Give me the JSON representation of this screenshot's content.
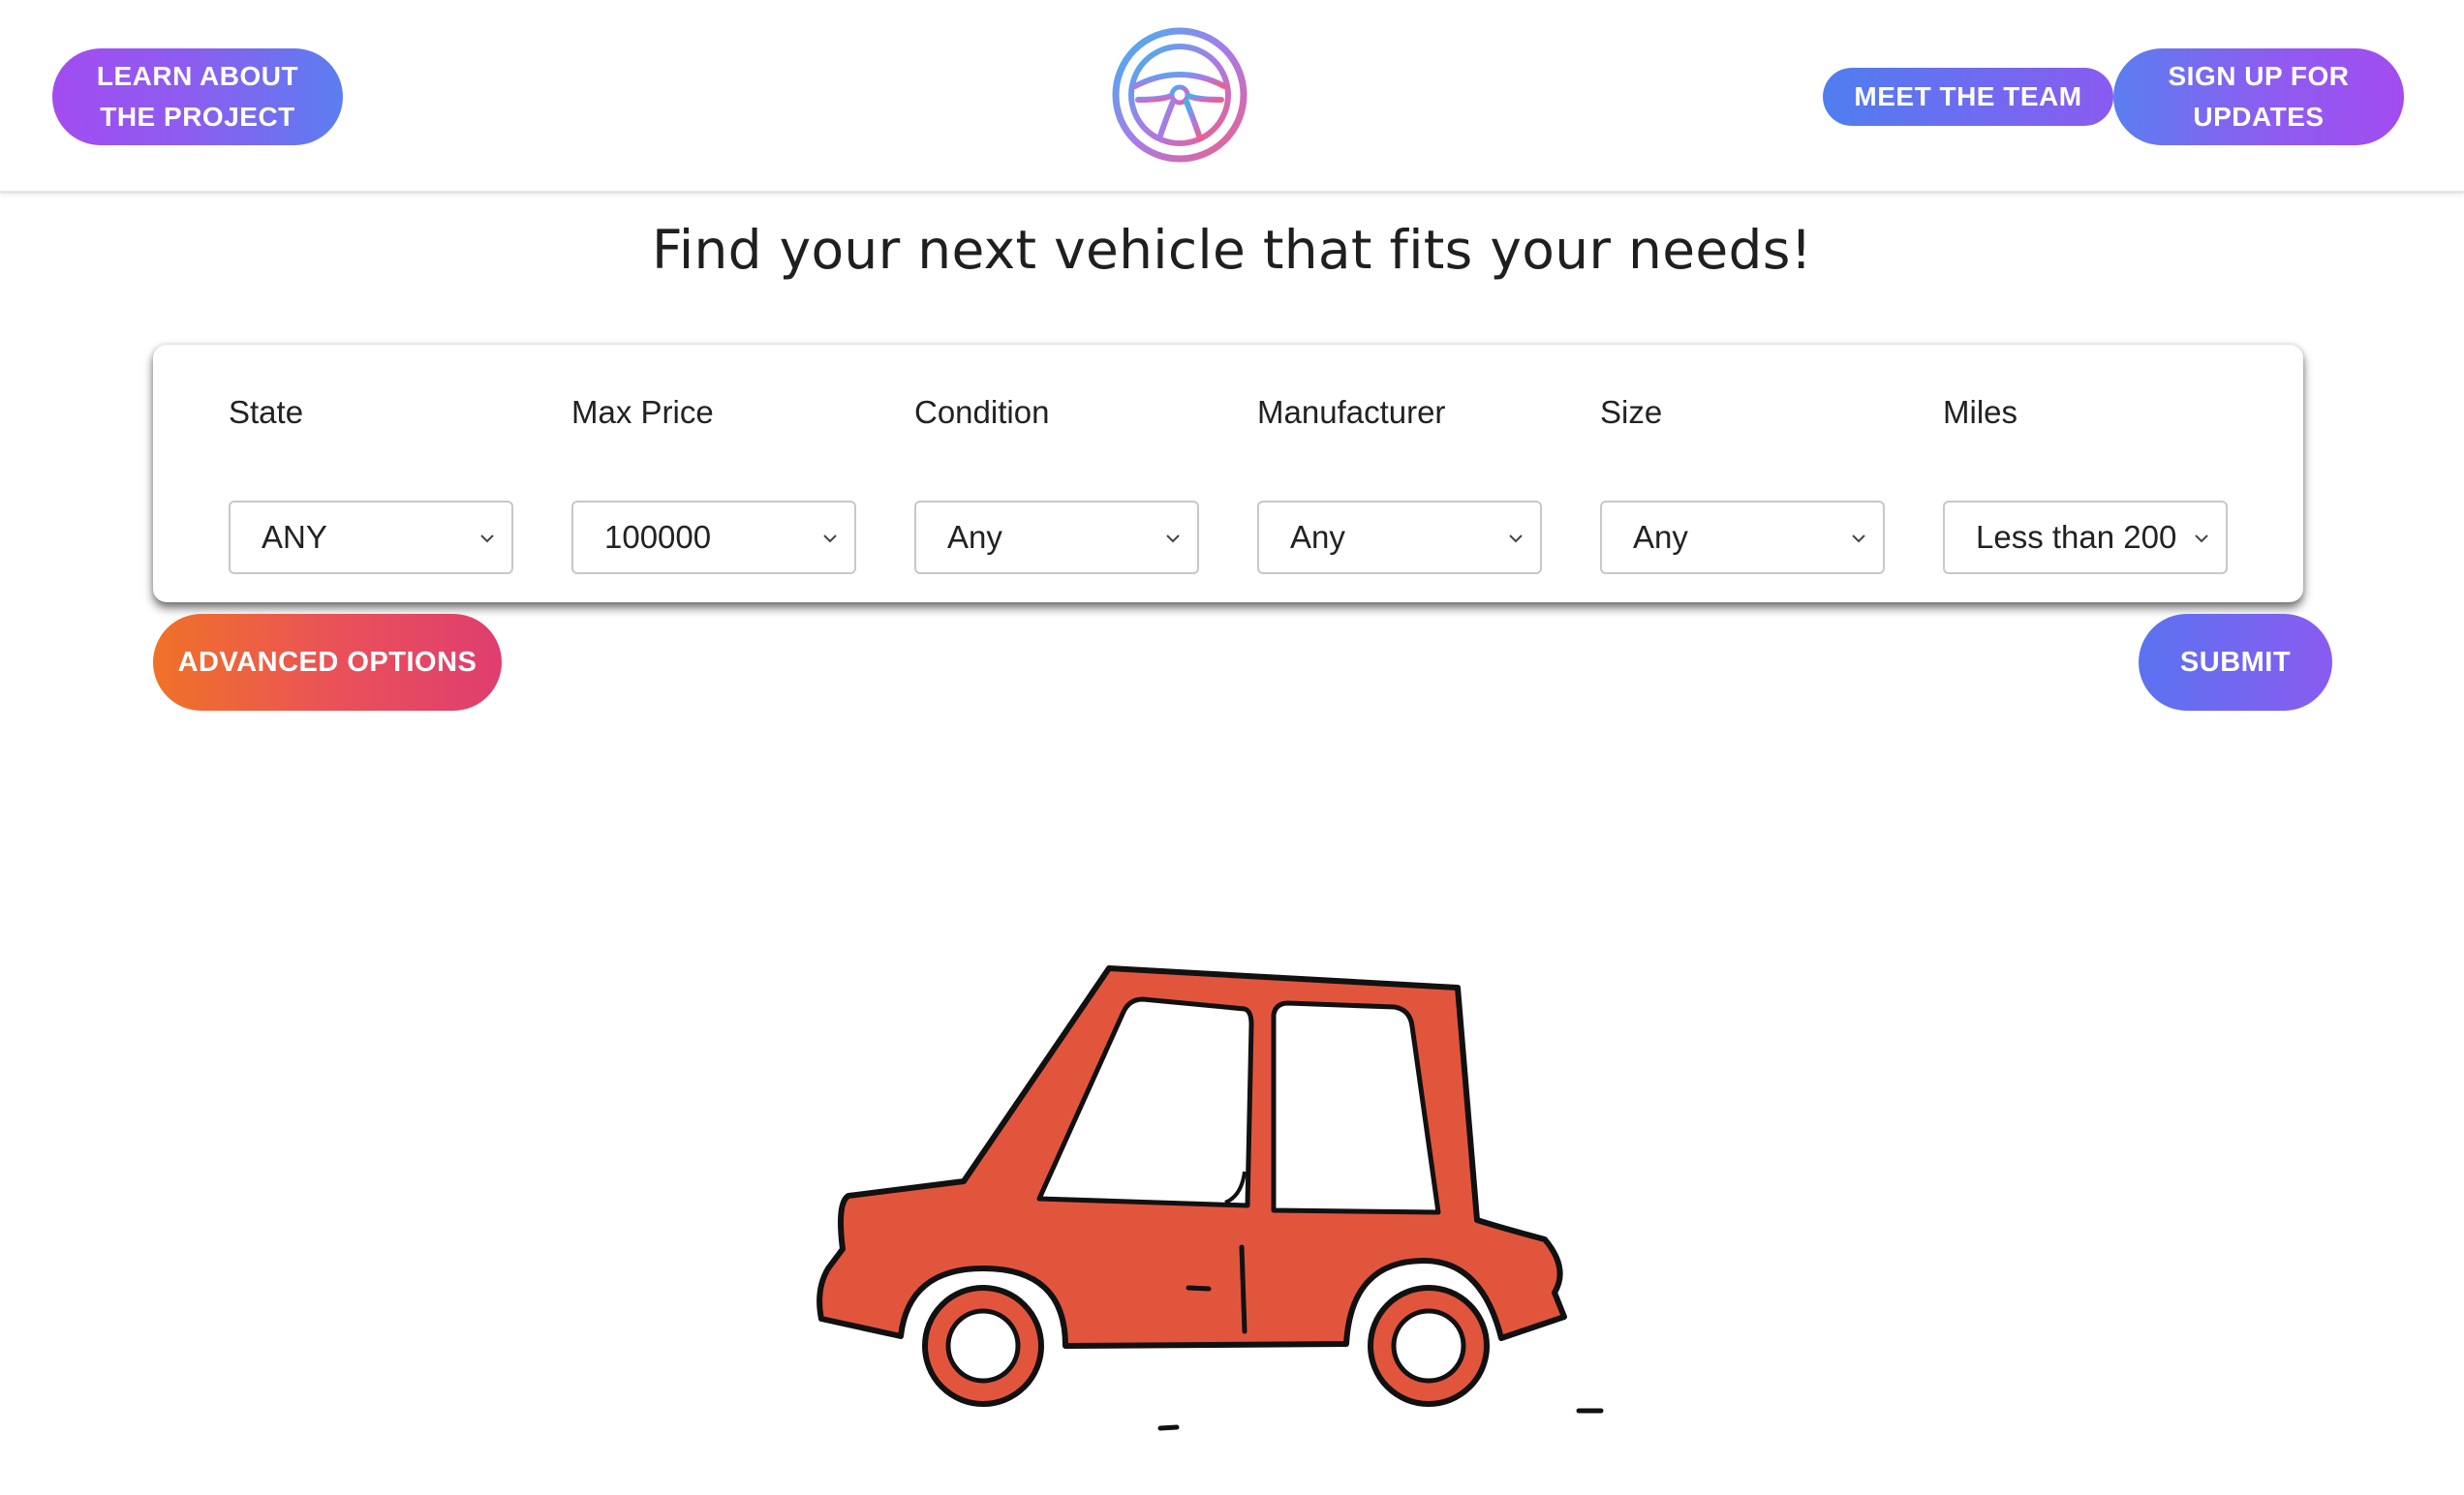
{
  "header": {
    "learn_label": "LEARN ABOUT THE PROJECT",
    "team_label": "MEET THE TEAM",
    "signup_label": "SIGN UP FOR UPDATES",
    "logo_icon": "steering-wheel-icon"
  },
  "main": {
    "heading": "Find your next vehicle that fits your needs!"
  },
  "filters": [
    {
      "label": "State",
      "value": "ANY"
    },
    {
      "label": "Max Price",
      "value": "100000"
    },
    {
      "label": "Condition",
      "value": "Any"
    },
    {
      "label": "Manufacturer",
      "value": "Any"
    },
    {
      "label": "Size",
      "value": "Any"
    },
    {
      "label": "Miles",
      "value": "Less than 200"
    }
  ],
  "actions": {
    "advanced_label": "ADVANCED OPTIONS",
    "submit_label": "SUBMIT"
  },
  "illustration": {
    "icon": "car-illustration",
    "car_color": "#e2553d"
  },
  "colors": {
    "purple": "#a24cf0",
    "blue": "#5b7ef0",
    "orange": "#f07228",
    "pink": "#df3d6f"
  }
}
